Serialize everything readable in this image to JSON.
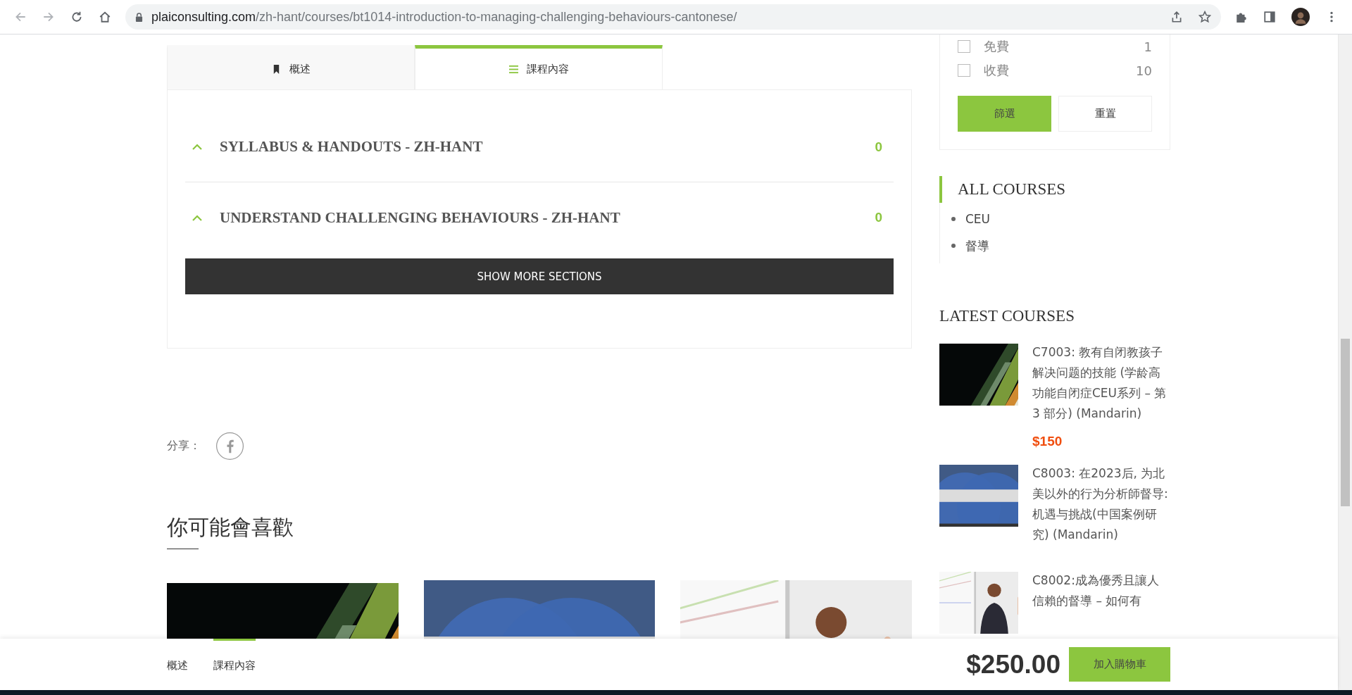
{
  "browser": {
    "host": "plaiconsulting.com",
    "path": "/zh-hant/courses/bt1014-introduction-to-managing-challenging-behaviours-cantonese/"
  },
  "tabs": [
    {
      "label": "概述",
      "selected": false
    },
    {
      "label": "課程內容",
      "selected": true
    }
  ],
  "sections": [
    {
      "title": "SYLLABUS & HANDOUTS - ZH-HANT",
      "count": "0",
      "expanded": true
    },
    {
      "title": "UNDERSTAND CHALLENGING BEHAVIOURS - ZH-HANT",
      "count": "0",
      "expanded": true
    }
  ],
  "show_more": "SHOW MORE SECTIONS",
  "share": {
    "label": "分享："
  },
  "related": {
    "heading": "你可能會喜歡"
  },
  "filter": {
    "options": [
      {
        "label": "免費",
        "count": "1",
        "checked": false
      },
      {
        "label": "收費",
        "count": "10",
        "checked": false
      }
    ],
    "buttons": [
      "篩選",
      "重置"
    ]
  },
  "all_courses": {
    "title": "ALL COURSES",
    "items": [
      "CEU",
      "督導"
    ]
  },
  "latest": {
    "title": "LATEST COURSES",
    "items": [
      {
        "title": "C7003: 教有自闭教孩子解决问题的技能 (学龄高功能自闭症CEU系列 – 第 3 部分) (Mandarin)",
        "price": "$150"
      },
      {
        "title": "C8003: 在2023后, 为北美以外的行为分析師督导: 机遇与挑战(中国案例研究) (Mandarin)"
      },
      {
        "title": "C8002:成為優秀且讓人信賴的督導 – 如何有"
      }
    ]
  },
  "bottom_bar": {
    "nav": [
      {
        "label": "概述",
        "selected": false
      },
      {
        "label": "課程內容",
        "selected": true
      }
    ],
    "price": "$250.00",
    "cart_button": "加入購物車"
  }
}
